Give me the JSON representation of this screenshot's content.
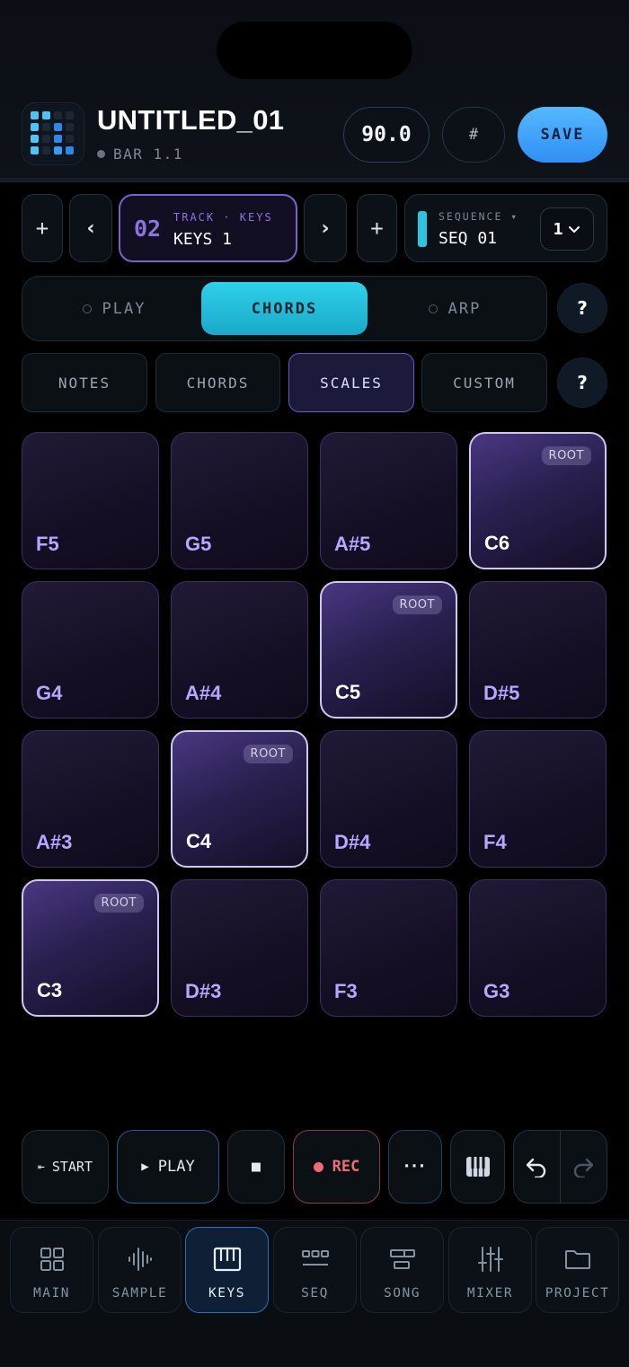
{
  "header": {
    "title": "UNTITLED_01",
    "position": "BAR 1.1",
    "bpm": "90.0",
    "key_button": "#",
    "save_label": "SAVE"
  },
  "track": {
    "add_left": "+",
    "prev": "‹",
    "number": "02",
    "label": "TRACK · KEYS",
    "name": "KEYS 1",
    "next": "›",
    "add_right": "+"
  },
  "sequence": {
    "label": "SEQUENCE ▾",
    "name": "SEQ 01",
    "selector_value": "1"
  },
  "modes": {
    "options": [
      "PLAY",
      "CHORDS",
      "ARP"
    ],
    "active": "CHORDS",
    "help": "?"
  },
  "layouts": {
    "options": [
      "NOTES",
      "CHORDS",
      "SCALES",
      "CUSTOM"
    ],
    "active": "SCALES",
    "help": "?"
  },
  "pads": [
    {
      "note": "F5",
      "root": false
    },
    {
      "note": "G5",
      "root": false
    },
    {
      "note": "A#5",
      "root": false
    },
    {
      "note": "C6",
      "root": true,
      "badge": "ROOT"
    },
    {
      "note": "G4",
      "root": false
    },
    {
      "note": "A#4",
      "root": false
    },
    {
      "note": "C5",
      "root": true,
      "badge": "ROOT"
    },
    {
      "note": "D#5",
      "root": false
    },
    {
      "note": "A#3",
      "root": false
    },
    {
      "note": "C4",
      "root": true,
      "badge": "ROOT"
    },
    {
      "note": "D#4",
      "root": false
    },
    {
      "note": "F4",
      "root": false
    },
    {
      "note": "C3",
      "root": true,
      "badge": "ROOT"
    },
    {
      "note": "D#3",
      "root": false
    },
    {
      "note": "F3",
      "root": false
    },
    {
      "note": "G3",
      "root": false
    }
  ],
  "transport": {
    "start": "START",
    "play": "PLAY",
    "stop": "■",
    "rec": "REC",
    "more": "···"
  },
  "nav": {
    "items": [
      "MAIN",
      "SAMPLE",
      "KEYS",
      "SEQ",
      "SONG",
      "MIXER",
      "PROJECT"
    ],
    "active": "KEYS"
  },
  "colors": {
    "accent_cyan": "#2ed0ea",
    "accent_blue": "#3fa2fb",
    "accent_purple": "#8c73e0",
    "rec_red": "#f06b7a"
  }
}
